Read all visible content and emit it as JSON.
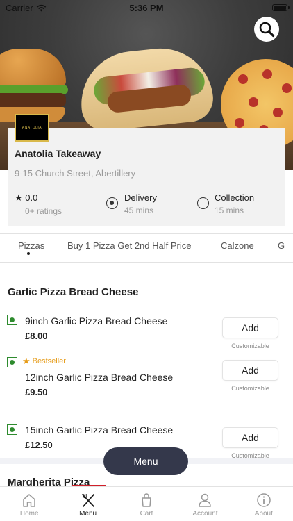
{
  "status_bar": {
    "carrier": "Carrier",
    "time": "5:36 PM"
  },
  "restaurant": {
    "name": "Anatolia Takeaway",
    "address": "9-15 Church Street, Abertillery",
    "logo_text": "ANATOLIA",
    "rating": {
      "value": "0.0",
      "count_label": "0+ ratings"
    },
    "delivery": {
      "label": "Delivery",
      "time": "45 mins",
      "selected": true
    },
    "collection": {
      "label": "Collection",
      "time": "15 mins",
      "selected": false
    }
  },
  "categories": [
    {
      "label": "Pizzas",
      "active": true
    },
    {
      "label": "Buy 1 Pizza Get 2nd Half Price",
      "active": false
    },
    {
      "label": "Calzone",
      "active": false
    },
    {
      "label": "G",
      "active": false
    }
  ],
  "sections": [
    {
      "title": "Garlic Pizza Bread Cheese",
      "items": [
        {
          "name": "9inch Garlic Pizza Bread Cheese",
          "price": "£8.00",
          "add_label": "Add",
          "note": "Customizable",
          "badge": ""
        },
        {
          "name": "12inch Garlic Pizza Bread Cheese",
          "price": "£9.50",
          "add_label": "Add",
          "note": "Customizable",
          "badge": "Bestseller"
        },
        {
          "name": "15inch Garlic Pizza Bread Cheese",
          "price": "£12.50",
          "add_label": "Add",
          "note": "Customizable",
          "badge": ""
        }
      ]
    },
    {
      "title": "Margherita Pizza"
    }
  ],
  "menu_button": "Menu",
  "bottom_nav": [
    {
      "label": "Home",
      "icon": "home-icon",
      "active": false
    },
    {
      "label": "Menu",
      "icon": "fork-knife-icon",
      "active": true
    },
    {
      "label": "Cart",
      "icon": "bag-icon",
      "active": false
    },
    {
      "label": "Account",
      "icon": "person-icon",
      "active": false
    },
    {
      "label": "About",
      "icon": "info-icon",
      "active": false
    }
  ],
  "colors": {
    "veg": "#2e8b2e",
    "bestseller": "#e69c1a",
    "menu_button": "#34384b",
    "accent_underline": "#d0202a"
  }
}
